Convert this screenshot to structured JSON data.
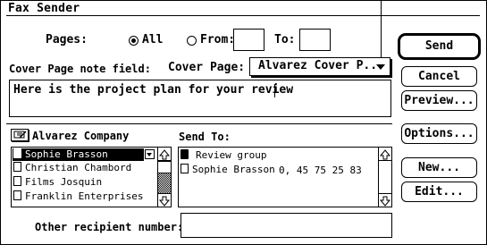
{
  "window": {
    "title": "Fax Sender"
  },
  "pages": {
    "label": "Pages:",
    "all_label": "All",
    "from_label": "From:",
    "to_label": "To:",
    "from_value": "",
    "to_value": "",
    "selected": "All"
  },
  "cover": {
    "note_label": "Cover Page note field:",
    "page_label": "Cover Page:",
    "page_value": "Alvarez Cover P...",
    "note_value": "Here is the project plan for your review"
  },
  "addressbook": {
    "name": "Alvarez Company",
    "items": [
      {
        "label": "Sophie Brasson",
        "selected": true
      },
      {
        "label": "Christian Chambord",
        "selected": false
      },
      {
        "label": "Films Josquin",
        "selected": false
      },
      {
        "label": "Franklin Enterprises",
        "selected": false
      }
    ]
  },
  "sendto": {
    "label": "Send To:",
    "items": [
      {
        "name": "Review group",
        "number": ""
      },
      {
        "name": "Sophie Brasson",
        "number": "0, 45 75 25 83"
      }
    ]
  },
  "other": {
    "label": "Other recipient number:",
    "value": ""
  },
  "buttons": {
    "send": "Send",
    "cancel": "Cancel",
    "preview": "Preview...",
    "options": "Options...",
    "new": "New...",
    "edit": "Edit..."
  },
  "icons": {
    "address_book": "address-book-icon",
    "person_card": "person-card-icon",
    "group": "group-icon",
    "popup_arrow": "triangle-down-icon",
    "scroll_up": "arrow-up-icon",
    "scroll_down": "arrow-down-icon"
  }
}
